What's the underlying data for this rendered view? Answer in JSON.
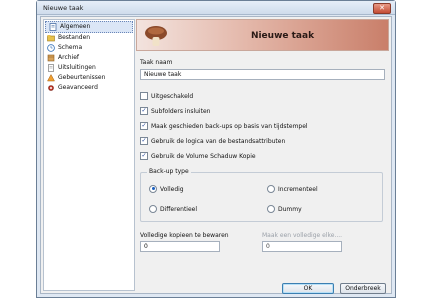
{
  "window": {
    "title": "Nieuwe taak",
    "close_glyph": "✕"
  },
  "sidebar": {
    "items": [
      {
        "label": "Algemeen",
        "icon": "general-icon",
        "selected": true
      },
      {
        "label": "Bestanden",
        "icon": "files-icon"
      },
      {
        "label": "Schema",
        "icon": "schedule-icon"
      },
      {
        "label": "Archief",
        "icon": "archive-icon"
      },
      {
        "label": "Uitsluitingen",
        "icon": "exclusions-icon"
      },
      {
        "label": "Gebeurtenissen",
        "icon": "events-icon"
      },
      {
        "label": "Geavanceerd",
        "icon": "advanced-icon"
      }
    ]
  },
  "header": {
    "title": "Nieuwe taak",
    "logo": "mushroom-logo"
  },
  "form": {
    "task_name_label": "Taak naam",
    "task_name_value": "Nieuwe taak",
    "checkboxes": [
      {
        "label": "Uitgeschakeld",
        "checked": false
      },
      {
        "label": "Subfolders insluiten",
        "checked": true
      },
      {
        "label": "Maak geschieden back-ups op basis van tijdstempel",
        "checked": true
      },
      {
        "label": "Gebruik de logica van de bestandsattributen",
        "checked": true
      },
      {
        "label": "Gebruik de Volume Schaduw Kopie",
        "checked": true
      }
    ],
    "backup_type": {
      "legend": "Back-up type",
      "options": [
        {
          "label": "Volledig",
          "selected": true
        },
        {
          "label": "Incrementeel",
          "selected": false
        },
        {
          "label": "Differentieel",
          "selected": false
        },
        {
          "label": "Dummy",
          "selected": false
        }
      ]
    },
    "full_copies_label": "Volledige kopieen te bewaren",
    "full_copies_value": "0",
    "full_every_label": "Maak een volledige elke....",
    "full_every_value": "0"
  },
  "buttons": {
    "ok": "OK",
    "cancel": "Onderbreek"
  },
  "colors": {
    "accent": "#1c5fbf",
    "header_gradient_end": "#c97f6a"
  }
}
